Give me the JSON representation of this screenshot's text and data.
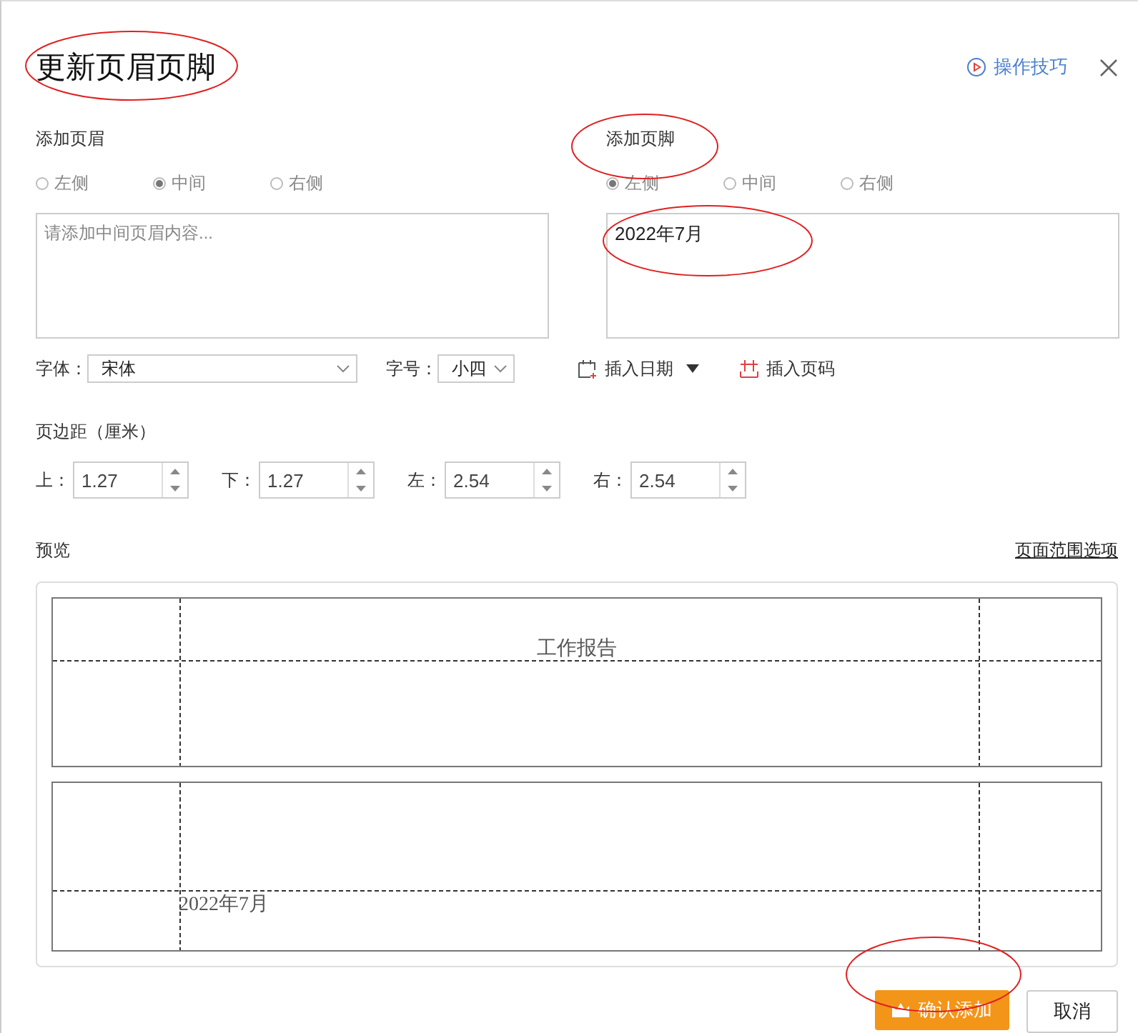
{
  "dialog": {
    "title": "更新页眉页脚",
    "help_link": "操作技巧"
  },
  "header": {
    "label": "添加页眉",
    "positions": [
      {
        "label": "左侧",
        "selected": false
      },
      {
        "label": "中间",
        "selected": true
      },
      {
        "label": "右侧",
        "selected": false
      }
    ],
    "placeholder": "请添加中间页眉内容..."
  },
  "footer": {
    "label": "添加页脚",
    "positions": [
      {
        "label": "左侧",
        "selected": true
      },
      {
        "label": "中间",
        "selected": false
      },
      {
        "label": "右侧",
        "selected": false
      }
    ],
    "value": "2022年7月"
  },
  "font": {
    "label": "字体：",
    "value": "宋体"
  },
  "size": {
    "label": "字号：",
    "value": "小四"
  },
  "insert_date": "插入日期",
  "insert_page_number": "插入页码",
  "margins": {
    "label": "页边距（厘米）",
    "fields": [
      {
        "label": "上：",
        "value": "1.27"
      },
      {
        "label": "下：",
        "value": "1.27"
      },
      {
        "label": "左：",
        "value": "2.54"
      },
      {
        "label": "右：",
        "value": "2.54"
      }
    ]
  },
  "preview": {
    "label": "预览",
    "range_link": "页面范围选项",
    "header_text": "工作报告",
    "footer_text": "2022年7月"
  },
  "buttons": {
    "confirm": "确认添加",
    "cancel": "取消"
  }
}
